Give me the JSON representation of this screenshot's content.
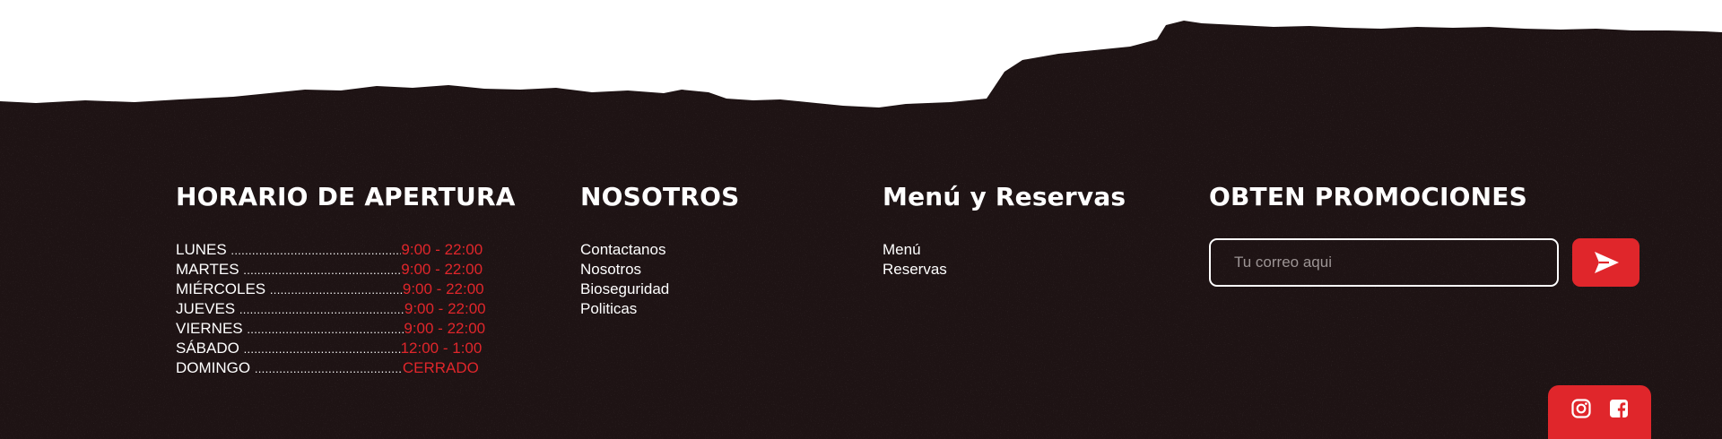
{
  "colors": {
    "background": "#1e1314",
    "accent": "#e0262b",
    "text": "#ffffff",
    "placeholder": "#9c9494"
  },
  "hours": {
    "title": "HORARIO DE APERTURA",
    "rows": [
      {
        "day": "LUNES",
        "dots": "............................................................",
        "time": "9:00 - 22:00"
      },
      {
        "day": "MARTES",
        "dots": ".....................................................",
        "time": "9:00 - 22:00"
      },
      {
        "day": "MIÉRCOLES",
        "dots": ".............................................",
        "time": "9:00 - 22:00"
      },
      {
        "day": "JUEVES",
        "dots": "........................................................",
        "time": "9:00 - 22:00"
      },
      {
        "day": "VIERNES",
        "dots": ".....................................................",
        "time": "9:00 - 22:00"
      },
      {
        "day": "SÁBADO",
        "dots": "....................................................",
        "time": "12:00 - 1:00"
      },
      {
        "day": "DOMINGO",
        "dots": "..........................................",
        "time": "CERRADO"
      }
    ]
  },
  "about": {
    "title": "NOSOTROS",
    "links": [
      "Contactanos",
      "Nosotros",
      "Bioseguridad",
      "Politicas"
    ]
  },
  "menu_reservas": {
    "title": "Menú y Reservas",
    "links": [
      "Menú",
      "Reservas"
    ]
  },
  "promo": {
    "title": "OBTEN PROMOCIONES",
    "email_placeholder": "Tu correo aqui",
    "email_value": "",
    "send_icon": "send-arrow-icon"
  },
  "social": {
    "icons": [
      "instagram-icon",
      "facebook-icon"
    ]
  }
}
